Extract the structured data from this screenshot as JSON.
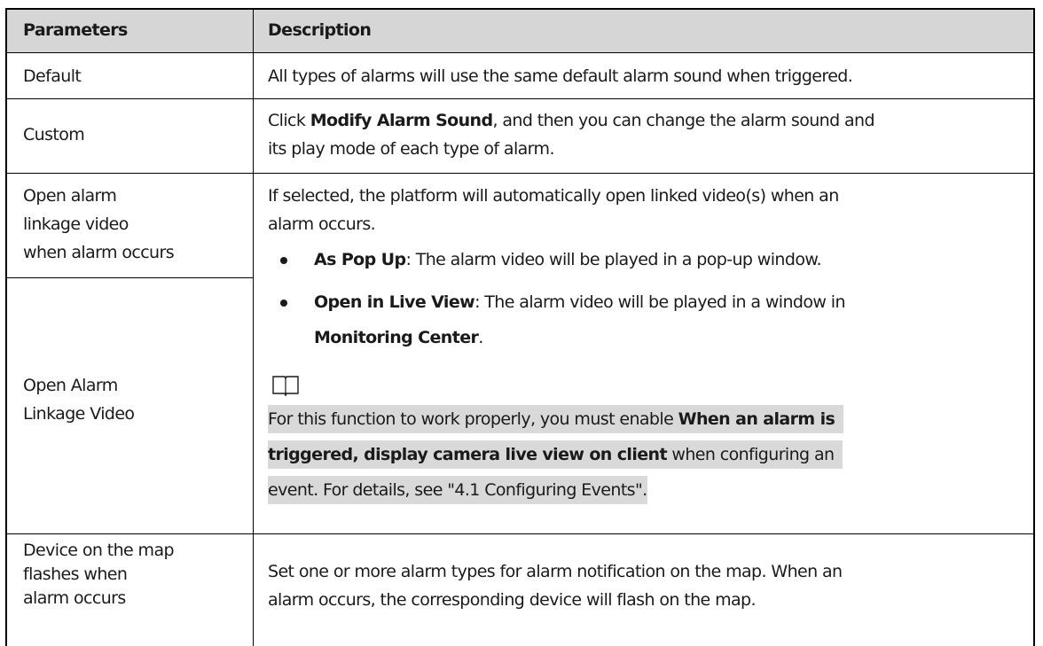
{
  "table": {
    "headers": [
      "Parameters",
      "Description"
    ],
    "rows": {
      "default": {
        "param": "Default",
        "desc": "All types of alarms will use the same default alarm sound when triggered."
      },
      "custom": {
        "param": "Custom",
        "desc_pre": "Click ",
        "desc_bold": "Modify Alarm Sound",
        "desc_post_line1": ", and then you can change the alarm sound and",
        "desc_line2": "its play mode of each type of alarm."
      },
      "open_video_when": {
        "param_line1": "Open alarm",
        "param_line2": "linkage video",
        "param_line3": "when alarm occurs"
      },
      "open_alarm_linkage": {
        "param_line1": "Open Alarm",
        "param_line2": "Linkage Video"
      },
      "video_desc": {
        "line1": "If selected, the platform will automatically open linked video(s) when an",
        "line2": "alarm occurs.",
        "bullets": [
          {
            "bold": "As Pop Up",
            "text": ": The alarm video will be played in a pop-up window."
          },
          {
            "bold": "Open in Live View",
            "text": ": The alarm video will be played in a window in"
          }
        ],
        "bullet2_cont_bold": "Monitoring Center",
        "bullet2_cont_text": ".",
        "note_icon": "book-icon",
        "note": {
          "l1_pre": "For this function to work properly, you must enable ",
          "l1_bold": "When an alarm is",
          "l2_bold": "triggered, display camera live view on client",
          "l2_post": " when configuring an",
          "l3": "event. For details, see \"4.1 Configuring Events\"."
        }
      },
      "device_flash": {
        "param_line1": "Device on the map",
        "param_line2": "flashes when",
        "param_line3": "alarm occurs",
        "desc_line1": "Set one or more alarm types for alarm notification on the map. When an",
        "desc_line2": "alarm occurs, the corresponding device will flash on the map."
      }
    }
  },
  "colors": {
    "header_bg": "#d6d6d6",
    "note_bg": "#d9d9d9",
    "border": "#000000"
  }
}
